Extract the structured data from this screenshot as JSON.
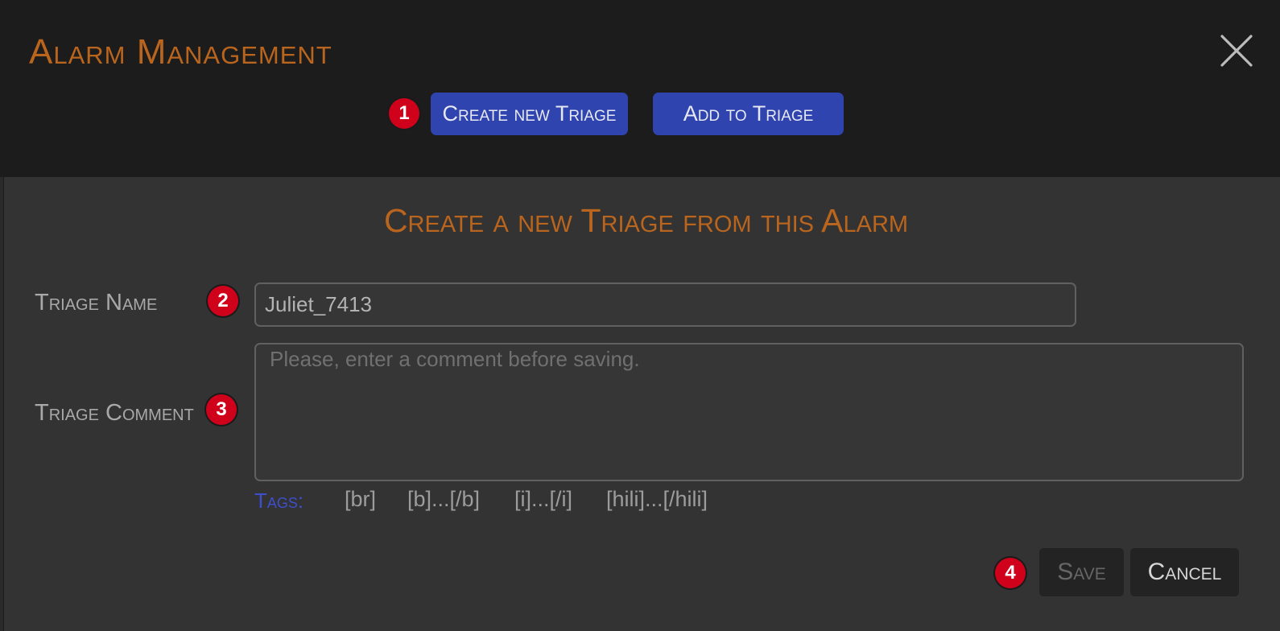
{
  "header": {
    "title": "Alarm Management",
    "close_icon": "close-icon",
    "actions": {
      "create_new_triage": "Create new Triage",
      "add_to_triage": "Add to Triage"
    }
  },
  "form": {
    "heading": "Create a new Triage from this Alarm",
    "triage_name": {
      "label": "Triage Name",
      "value": "Juliet_7413"
    },
    "triage_comment": {
      "label": "Triage Comment",
      "placeholder": "Please, enter a comment before saving."
    },
    "tags": {
      "label": "Tags:",
      "items": [
        "[br]",
        "[b]...[/b]",
        "[i]...[/i]",
        "[hili]...[/hili]"
      ]
    },
    "buttons": {
      "save": "Save",
      "save_disabled": true,
      "cancel": "Cancel"
    }
  },
  "step_badges": [
    "1",
    "2",
    "3",
    "4"
  ],
  "colors": {
    "accent": "#b9651e",
    "primary_button": "#2f44ae",
    "tags_label": "#3d4fcc",
    "badge": "#d0021b",
    "header_bg": "#1c1c1c",
    "panel_bg": "#333333"
  }
}
